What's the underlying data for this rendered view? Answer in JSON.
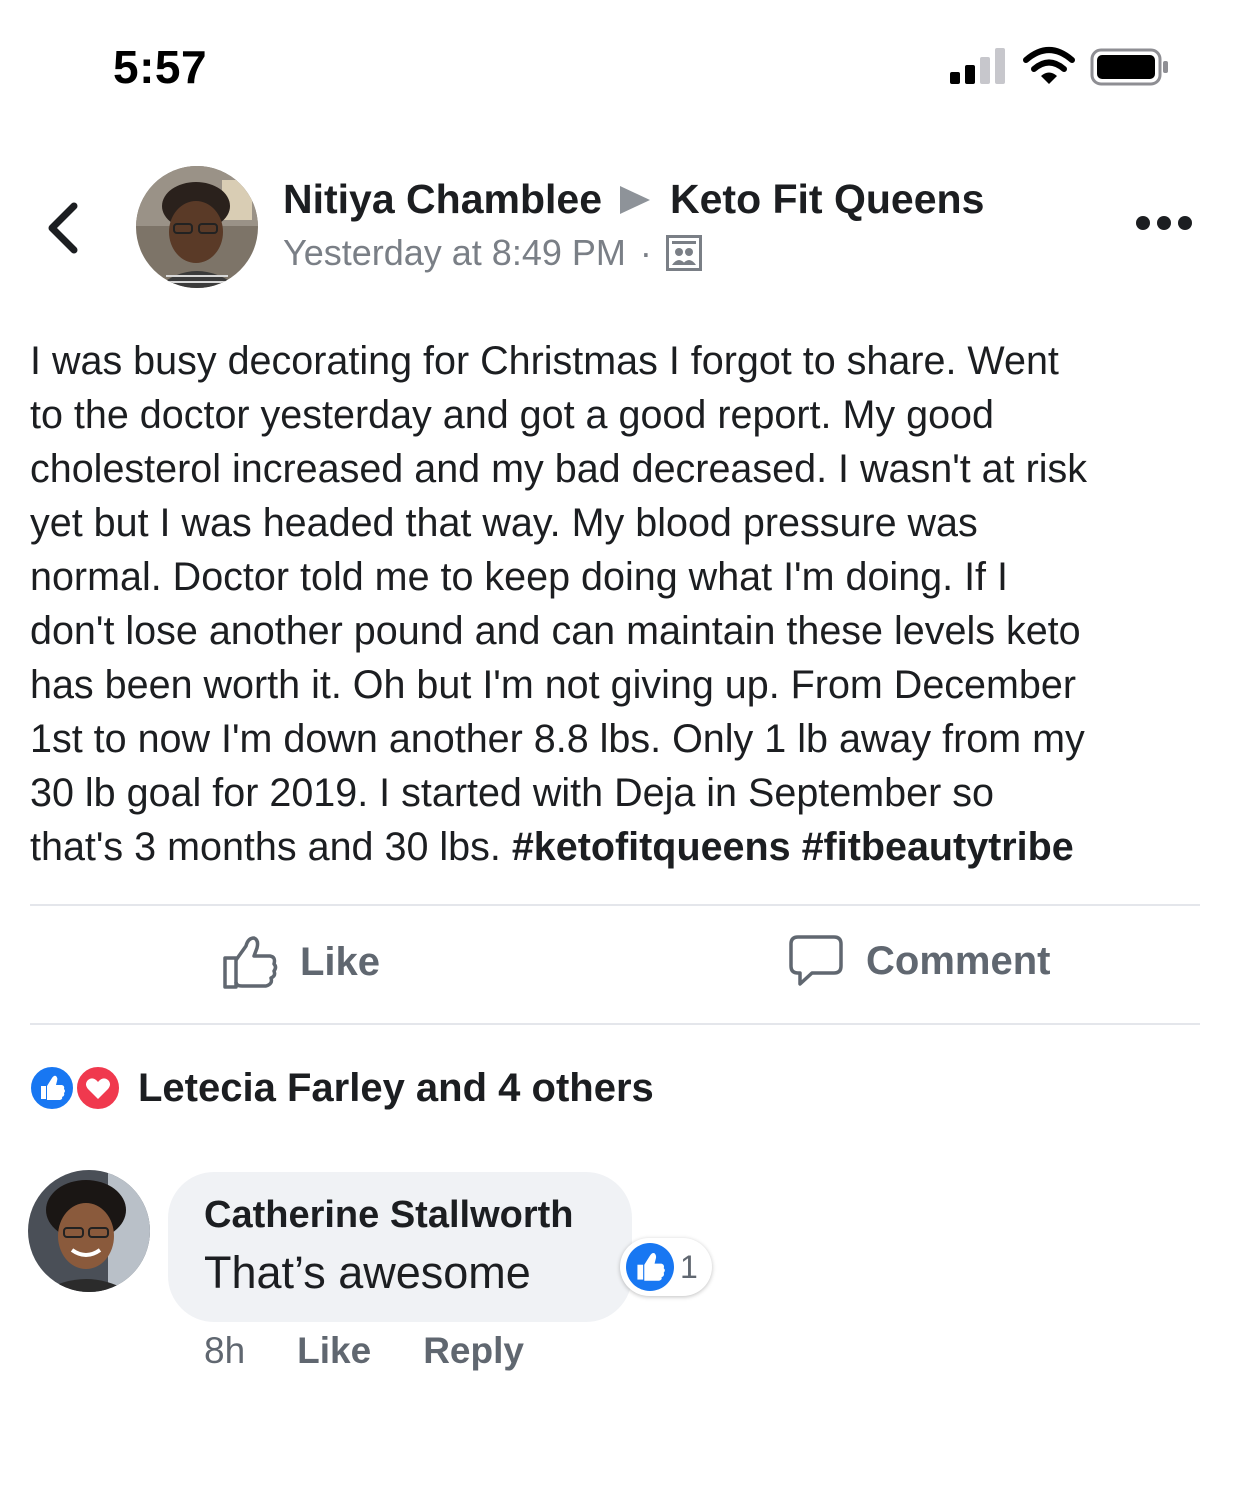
{
  "status_bar": {
    "time": "5:57"
  },
  "post": {
    "author": "Nitiya Chamblee",
    "group": "Keto Fit Queens",
    "timestamp": "Yesterday at 8:49 PM",
    "separator": "·",
    "body_lines": [
      "I was busy decorating for Christmas I forgot to share. Went",
      "to the doctor yesterday and got a good report. My good",
      "cholesterol increased and my bad decreased. I wasn't at risk",
      "yet but I was headed that way. My blood pressure was",
      "normal. Doctor told me to keep doing what I'm doing. If I",
      "don't lose another pound and can maintain these levels keto",
      "has been worth it. Oh but I'm not giving up. From December",
      "1st to now I'm down another 8.8 lbs. Only 1 lb away from my",
      "30 lb goal for 2019. I started with Deja in September so"
    ],
    "last_line_text": "that's 3 months and 30 lbs. ",
    "hashtags": [
      "#ketofitqueens",
      "#fitbeautytribe"
    ]
  },
  "actions": {
    "like_label": "Like",
    "comment_label": "Comment"
  },
  "reactions": {
    "icons": [
      "like-reaction-icon",
      "love-reaction-icon"
    ],
    "summary": "Letecia Farley and 4 others"
  },
  "comment": {
    "author": "Catherine Stallworth",
    "text": "That’s awesome",
    "reaction_count": "1",
    "age": "8h",
    "like_label": "Like",
    "reply_label": "Reply"
  },
  "colors": {
    "facebook_blue": "#1877f2",
    "love_red": "#f0394e",
    "secondary_text": "#606770",
    "bubble_bg": "#f0f2f5"
  }
}
